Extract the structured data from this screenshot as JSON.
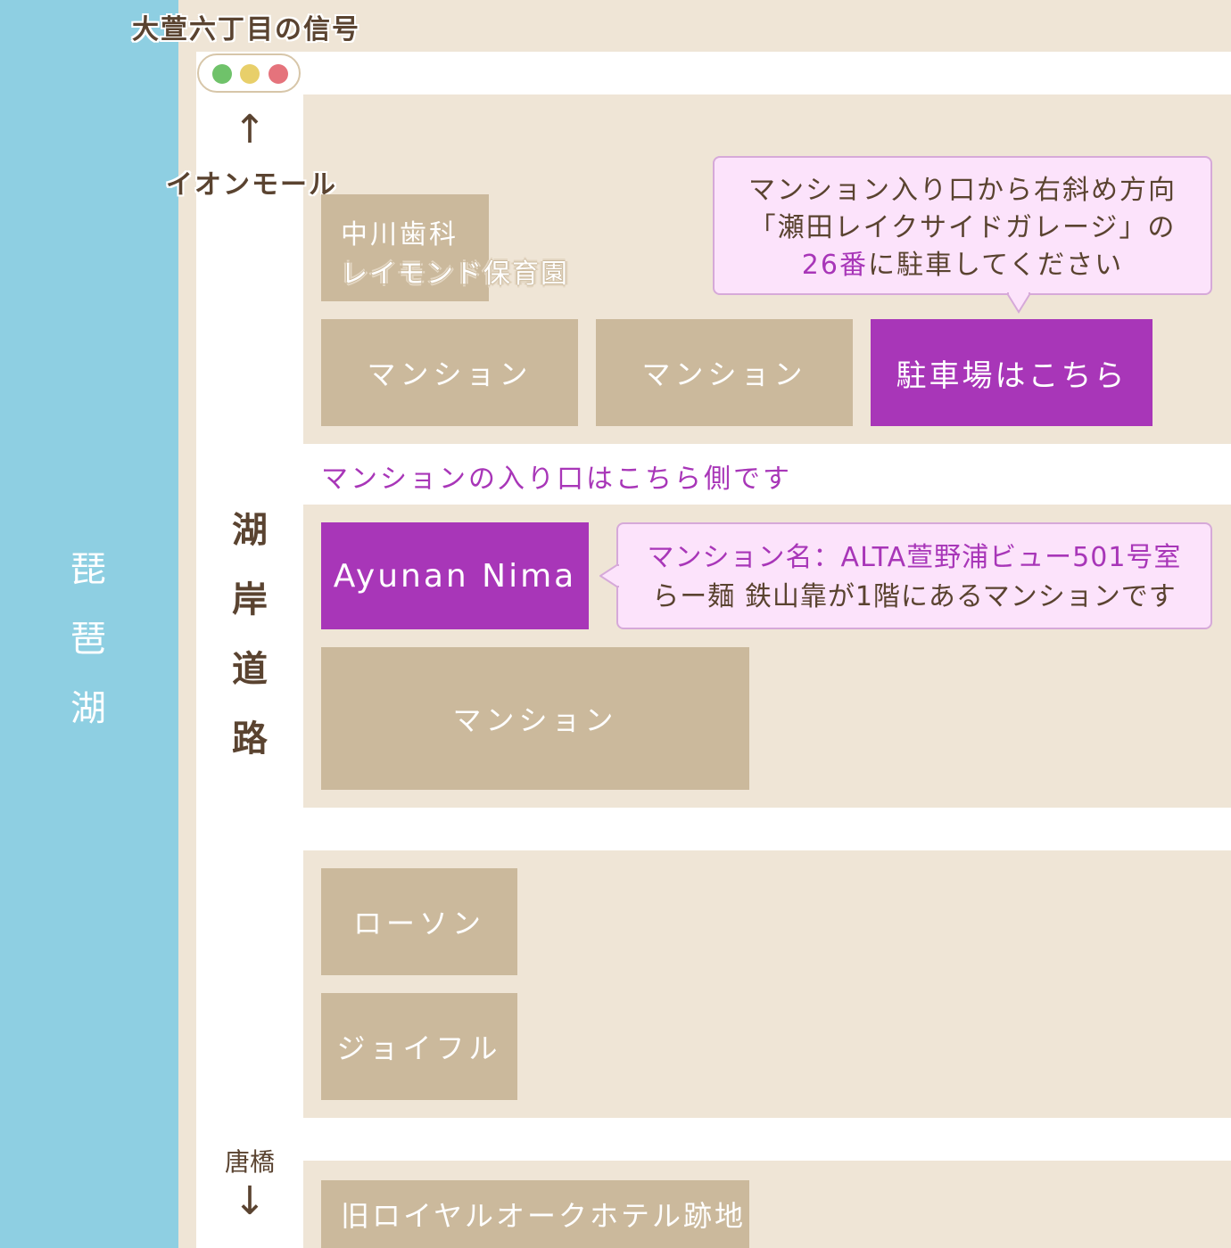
{
  "lake": {
    "label_chars": [
      "琵",
      "琶",
      "湖"
    ]
  },
  "road": {
    "label_chars": [
      "湖",
      "岸",
      "道",
      "路"
    ]
  },
  "signal": {
    "label": "大萱六丁目の信号",
    "lamp_colors": [
      "#6fc26a",
      "#e8cf6a",
      "#e5737c"
    ]
  },
  "north": {
    "arrow": "↑",
    "label": "イオンモール"
  },
  "south": {
    "label": "唐橋",
    "arrow": "↓"
  },
  "blocks": {
    "dental": {
      "line1": "中川歯科",
      "line2": "レイモンド保育園"
    },
    "mansion_a": "マンション",
    "mansion_b": "マンション",
    "parking": "駐車場はこちら",
    "entrance_note": "マンションの入り口はこちら側です",
    "ayunan": "Ayunan Nima",
    "mansion_c": "マンション",
    "lawson": "ローソン",
    "joyfull": "ジョイフル",
    "royal_oak": "旧ロイヤルオークホテル跡地"
  },
  "callouts": {
    "parking": {
      "line1": "マンション入り口から右斜め方向",
      "line2": "「瀬田レイクサイドガレージ」の",
      "line3_highlight": "26番",
      "line3_rest": "に駐車してください"
    },
    "ayunan": {
      "line1_highlight": "マンション名：ALTA萱野浦ビュー501号室",
      "line2": "らー麺 鉄山靠が1階にあるマンションです"
    }
  },
  "colors": {
    "lake": "#8ecfe2",
    "ground": "#efe5d6",
    "building": "#cbb99c",
    "highlight": "#a836b8",
    "callout_bg": "#fce3fb"
  }
}
